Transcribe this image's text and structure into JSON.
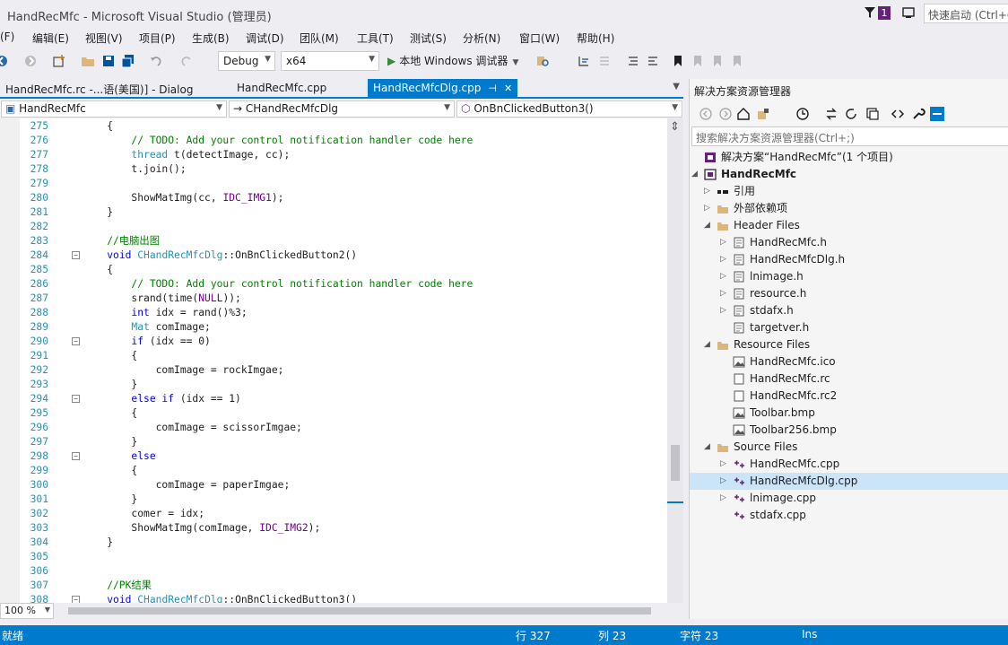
{
  "window": {
    "title": "HandRecMfc - Microsoft Visual Studio (管理员)",
    "notification_count": "1",
    "quick_launch_placeholder": "快速启动 (Ctrl+Q)"
  },
  "menu": [
    {
      "label": "(F)"
    },
    {
      "label": "编辑(E)"
    },
    {
      "label": "视图(V)"
    },
    {
      "label": "项目(P)"
    },
    {
      "label": "生成(B)"
    },
    {
      "label": "调试(D)"
    },
    {
      "label": "团队(M)"
    },
    {
      "label": "工具(T)"
    },
    {
      "label": "测试(S)"
    },
    {
      "label": "分析(N)"
    },
    {
      "label": "窗口(W)"
    },
    {
      "label": "帮助(H)"
    }
  ],
  "toolbar": {
    "config": "Debug",
    "platform": "x64",
    "run_label": "本地 Windows 调试器"
  },
  "doc_tabs": [
    {
      "label": "HandRecMfc.rc -...语(美国)] - Dialog",
      "active": false
    },
    {
      "label": "HandRecMfc.cpp",
      "active": false
    },
    {
      "label": "HandRecMfcDlg.cpp",
      "active": true
    }
  ],
  "nav": {
    "project": "HandRecMfc",
    "class": "CHandRecMfcDlg",
    "member": "OnBnClickedButton3()"
  },
  "code_lines": [
    {
      "n": "275",
      "fold": "",
      "segs": [
        {
          "t": "    {",
          "c": ""
        }
      ]
    },
    {
      "n": "276",
      "fold": "",
      "segs": [
        {
          "t": "        // TODO: Add your control notification handler code here",
          "c": "c-com"
        }
      ]
    },
    {
      "n": "277",
      "fold": "",
      "segs": [
        {
          "t": "        ",
          "c": ""
        },
        {
          "t": "thread",
          "c": "c-type"
        },
        {
          "t": " t(detectImage, cc);",
          "c": ""
        }
      ]
    },
    {
      "n": "278",
      "fold": "",
      "segs": [
        {
          "t": "        t.join();",
          "c": ""
        }
      ]
    },
    {
      "n": "279",
      "fold": "",
      "segs": [
        {
          "t": "",
          "c": ""
        }
      ]
    },
    {
      "n": "280",
      "fold": "",
      "segs": [
        {
          "t": "        ShowMatImg(cc, ",
          "c": ""
        },
        {
          "t": "IDC_IMG1",
          "c": "c-macro"
        },
        {
          "t": ");",
          "c": ""
        }
      ]
    },
    {
      "n": "281",
      "fold": "",
      "segs": [
        {
          "t": "    }",
          "c": ""
        }
      ]
    },
    {
      "n": "282",
      "fold": "",
      "segs": [
        {
          "t": "",
          "c": ""
        }
      ]
    },
    {
      "n": "283",
      "fold": "",
      "segs": [
        {
          "t": "    //电脑出图",
          "c": "c-com"
        }
      ]
    },
    {
      "n": "284",
      "fold": "−",
      "segs": [
        {
          "t": "    ",
          "c": ""
        },
        {
          "t": "void",
          "c": "c-kw"
        },
        {
          "t": " ",
          "c": ""
        },
        {
          "t": "CHandRecMfcDlg",
          "c": "c-type"
        },
        {
          "t": "::OnBnClickedButton2()",
          "c": ""
        }
      ]
    },
    {
      "n": "285",
      "fold": "",
      "segs": [
        {
          "t": "    {",
          "c": ""
        }
      ]
    },
    {
      "n": "286",
      "fold": "",
      "segs": [
        {
          "t": "        // TODO: Add your control notification handler code here",
          "c": "c-com"
        }
      ]
    },
    {
      "n": "287",
      "fold": "",
      "segs": [
        {
          "t": "        srand(time(",
          "c": ""
        },
        {
          "t": "NULL",
          "c": "c-macro"
        },
        {
          "t": "));",
          "c": ""
        }
      ]
    },
    {
      "n": "288",
      "fold": "",
      "segs": [
        {
          "t": "        ",
          "c": ""
        },
        {
          "t": "int",
          "c": "c-kw"
        },
        {
          "t": " idx = rand()%3;",
          "c": ""
        }
      ]
    },
    {
      "n": "289",
      "fold": "",
      "segs": [
        {
          "t": "        ",
          "c": ""
        },
        {
          "t": "Mat",
          "c": "c-type"
        },
        {
          "t": " comImage;",
          "c": ""
        }
      ]
    },
    {
      "n": "290",
      "fold": "−",
      "segs": [
        {
          "t": "        ",
          "c": ""
        },
        {
          "t": "if",
          "c": "c-kw"
        },
        {
          "t": " (idx == 0)",
          "c": ""
        }
      ]
    },
    {
      "n": "291",
      "fold": "",
      "segs": [
        {
          "t": "        {",
          "c": ""
        }
      ]
    },
    {
      "n": "292",
      "fold": "",
      "segs": [
        {
          "t": "            comImage = rockImgae;",
          "c": ""
        }
      ]
    },
    {
      "n": "293",
      "fold": "",
      "segs": [
        {
          "t": "        }",
          "c": ""
        }
      ]
    },
    {
      "n": "294",
      "fold": "−",
      "segs": [
        {
          "t": "        ",
          "c": ""
        },
        {
          "t": "else if",
          "c": "c-kw"
        },
        {
          "t": " (idx == 1)",
          "c": ""
        }
      ]
    },
    {
      "n": "295",
      "fold": "",
      "segs": [
        {
          "t": "        {",
          "c": ""
        }
      ]
    },
    {
      "n": "296",
      "fold": "",
      "segs": [
        {
          "t": "            comImage = scissorImgae;",
          "c": ""
        }
      ]
    },
    {
      "n": "297",
      "fold": "",
      "segs": [
        {
          "t": "        }",
          "c": ""
        }
      ]
    },
    {
      "n": "298",
      "fold": "−",
      "segs": [
        {
          "t": "        ",
          "c": ""
        },
        {
          "t": "else",
          "c": "c-kw"
        }
      ]
    },
    {
      "n": "299",
      "fold": "",
      "segs": [
        {
          "t": "        {",
          "c": ""
        }
      ]
    },
    {
      "n": "300",
      "fold": "",
      "segs": [
        {
          "t": "            comImage = paperImgae;",
          "c": ""
        }
      ]
    },
    {
      "n": "301",
      "fold": "",
      "segs": [
        {
          "t": "        }",
          "c": ""
        }
      ]
    },
    {
      "n": "302",
      "fold": "",
      "segs": [
        {
          "t": "        comer = idx;",
          "c": ""
        }
      ]
    },
    {
      "n": "303",
      "fold": "",
      "segs": [
        {
          "t": "        ShowMatImg(comImage, ",
          "c": ""
        },
        {
          "t": "IDC_IMG2",
          "c": "c-macro"
        },
        {
          "t": ");",
          "c": ""
        }
      ]
    },
    {
      "n": "304",
      "fold": "",
      "segs": [
        {
          "t": "    }",
          "c": ""
        }
      ]
    },
    {
      "n": "305",
      "fold": "",
      "segs": [
        {
          "t": "",
          "c": ""
        }
      ]
    },
    {
      "n": "306",
      "fold": "",
      "segs": [
        {
          "t": "",
          "c": ""
        }
      ]
    },
    {
      "n": "307",
      "fold": "",
      "segs": [
        {
          "t": "    //PK结果",
          "c": "c-com"
        }
      ]
    },
    {
      "n": "308",
      "fold": "−",
      "segs": [
        {
          "t": "    ",
          "c": ""
        },
        {
          "t": "void",
          "c": "c-kw"
        },
        {
          "t": " ",
          "c": ""
        },
        {
          "t": "CHandRecMfcDlg",
          "c": "c-type"
        },
        {
          "t": "::OnBnClickedButton3()",
          "c": ""
        }
      ]
    }
  ],
  "editor_bottom": {
    "zoom": "100 %"
  },
  "solution_explorer": {
    "title": "解决方案资源管理器",
    "search_placeholder": "搜索解决方案资源管理器(Ctrl+;)",
    "tree": [
      {
        "label": "解决方案“HandRecMfc”(1 个项目)",
        "level": 0,
        "exp": "",
        "icon": "solution-icon",
        "bold": false,
        "selected": false
      },
      {
        "label": "HandRecMfc",
        "level": 0,
        "exp": "◢",
        "icon": "project-icon",
        "bold": true,
        "selected": false
      },
      {
        "label": "引用",
        "level": 1,
        "exp": "▷",
        "icon": "references-icon",
        "bold": false,
        "selected": false
      },
      {
        "label": "外部依赖项",
        "level": 1,
        "exp": "▷",
        "icon": "external-deps-icon",
        "bold": false,
        "selected": false
      },
      {
        "label": "Header Files",
        "level": 1,
        "exp": "◢",
        "icon": "folder-icon",
        "bold": false,
        "selected": false
      },
      {
        "label": "HandRecMfc.h",
        "level": 2,
        "exp": "▷",
        "icon": "header-file-icon",
        "bold": false,
        "selected": false
      },
      {
        "label": "HandRecMfcDlg.h",
        "level": 2,
        "exp": "▷",
        "icon": "header-file-icon",
        "bold": false,
        "selected": false
      },
      {
        "label": "lnimage.h",
        "level": 2,
        "exp": "▷",
        "icon": "header-file-icon",
        "bold": false,
        "selected": false
      },
      {
        "label": "resource.h",
        "level": 2,
        "exp": "▷",
        "icon": "header-file-icon",
        "bold": false,
        "selected": false
      },
      {
        "label": "stdafx.h",
        "level": 2,
        "exp": "▷",
        "icon": "header-file-icon",
        "bold": false,
        "selected": false
      },
      {
        "label": "targetver.h",
        "level": 2,
        "exp": "",
        "icon": "header-file-icon",
        "bold": false,
        "selected": false
      },
      {
        "label": "Resource Files",
        "level": 1,
        "exp": "◢",
        "icon": "folder-icon",
        "bold": false,
        "selected": false
      },
      {
        "label": "HandRecMfc.ico",
        "level": 2,
        "exp": "",
        "icon": "image-file-icon",
        "bold": false,
        "selected": false
      },
      {
        "label": "HandRecMfc.rc",
        "level": 2,
        "exp": "",
        "icon": "resource-file-icon",
        "bold": false,
        "selected": false
      },
      {
        "label": "HandRecMfc.rc2",
        "level": 2,
        "exp": "",
        "icon": "resource-file-icon",
        "bold": false,
        "selected": false
      },
      {
        "label": "Toolbar.bmp",
        "level": 2,
        "exp": "",
        "icon": "image-file-icon",
        "bold": false,
        "selected": false
      },
      {
        "label": "Toolbar256.bmp",
        "level": 2,
        "exp": "",
        "icon": "image-file-icon",
        "bold": false,
        "selected": false
      },
      {
        "label": "Source Files",
        "level": 1,
        "exp": "◢",
        "icon": "folder-icon",
        "bold": false,
        "selected": false
      },
      {
        "label": "HandRecMfc.cpp",
        "level": 2,
        "exp": "▷",
        "icon": "cpp-file-icon",
        "bold": false,
        "selected": false
      },
      {
        "label": "HandRecMfcDlg.cpp",
        "level": 2,
        "exp": "▷",
        "icon": "cpp-file-icon",
        "bold": false,
        "selected": true
      },
      {
        "label": "lnimage.cpp",
        "level": 2,
        "exp": "▷",
        "icon": "cpp-file-icon",
        "bold": false,
        "selected": false
      },
      {
        "label": "stdafx.cpp",
        "level": 2,
        "exp": "",
        "icon": "cpp-file-icon",
        "bold": false,
        "selected": false
      }
    ]
  },
  "status": {
    "state": "就绪",
    "row": "行 327",
    "col": "列 23",
    "ch": "字符 23",
    "mode": "Ins"
  },
  "colors": {
    "accent": "#007acc",
    "status_bg": "#007acc",
    "selected_row": "#cce4f7"
  }
}
